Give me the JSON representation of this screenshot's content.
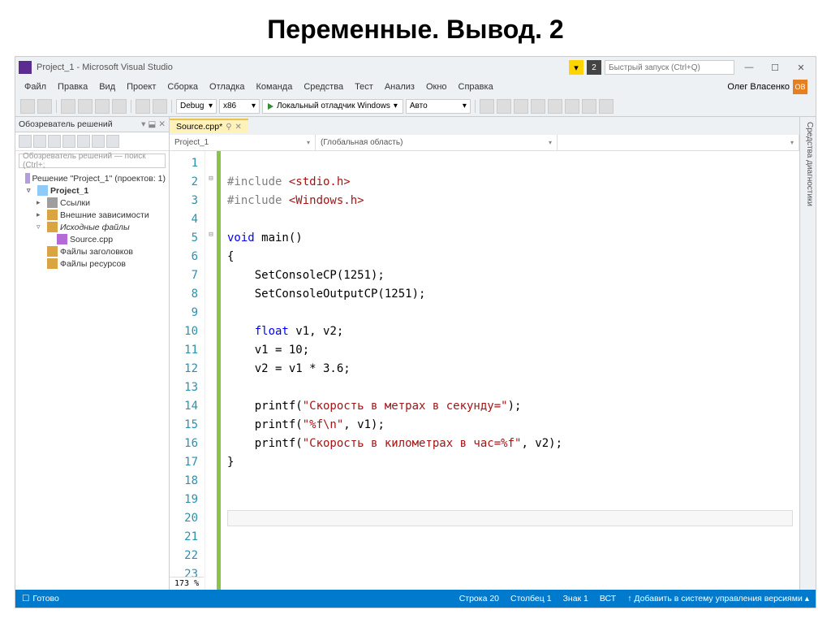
{
  "slide_title": "Переменные. Вывод. 2",
  "window_title": "Project_1 - Microsoft Visual Studio",
  "quick_launch_placeholder": "Быстрый запуск (Ctrl+Q)",
  "notification_count": "2",
  "user_name": "Олег Власенко",
  "avatar_initials": "ОВ",
  "menu": [
    "Файл",
    "Правка",
    "Вид",
    "Проект",
    "Сборка",
    "Отладка",
    "Команда",
    "Средства",
    "Тест",
    "Анализ",
    "Окно",
    "Справка"
  ],
  "toolbar": {
    "config": "Debug",
    "platform": "x86",
    "run_label": "Локальный отладчик Windows",
    "config2": "Авто"
  },
  "solution_pane": {
    "title": "Обозреватель решений",
    "search_placeholder": "Обозреватель решений — поиск (Ctrl+;",
    "solution_label": "Решение \"Project_1\" (проектов: 1)",
    "project": "Project_1",
    "nodes": {
      "refs": "Ссылки",
      "ext": "Внешние зависимости",
      "src": "Исходные файлы",
      "srcfile": "Source.cpp",
      "hdr": "Файлы заголовков",
      "res": "Файлы ресурсов"
    }
  },
  "editor": {
    "tab_name": "Source.cpp*",
    "nav_project": "Project_1",
    "nav_scope": "(Глобальная область)",
    "zoom": "173 %"
  },
  "code": {
    "l2a": "#include ",
    "l2b": "<stdio.h>",
    "l3a": "#include ",
    "l3b": "<Windows.h>",
    "l5a": "void",
    "l5b": " main()",
    "l6": "{",
    "l7": "    SetConsoleCP(1251);",
    "l8": "    SetConsoleOutputCP(1251);",
    "l10a": "    ",
    "l10b": "float",
    "l10c": " v1, v2;",
    "l11": "    v1 = 10;",
    "l12": "    v2 = v1 * 3.6;",
    "l14a": "    printf(",
    "l14b": "\"Скорость в метрах в секунду=\"",
    "l14c": ");",
    "l15a": "    printf(",
    "l15b": "\"%f\\n\"",
    "l15c": ", v1);",
    "l16a": "    printf(",
    "l16b": "\"Скорость в километрах в час=%f\"",
    "l16c": ", v2);",
    "l17": "}"
  },
  "rail_label": "Средства диагностики",
  "statusbar": {
    "ready": "Готово",
    "line": "Строка 20",
    "col": "Столбец 1",
    "char": "Знак 1",
    "ins": "ВСТ",
    "vcs": "↑  Добавить в систему управления версиями  ▴"
  }
}
